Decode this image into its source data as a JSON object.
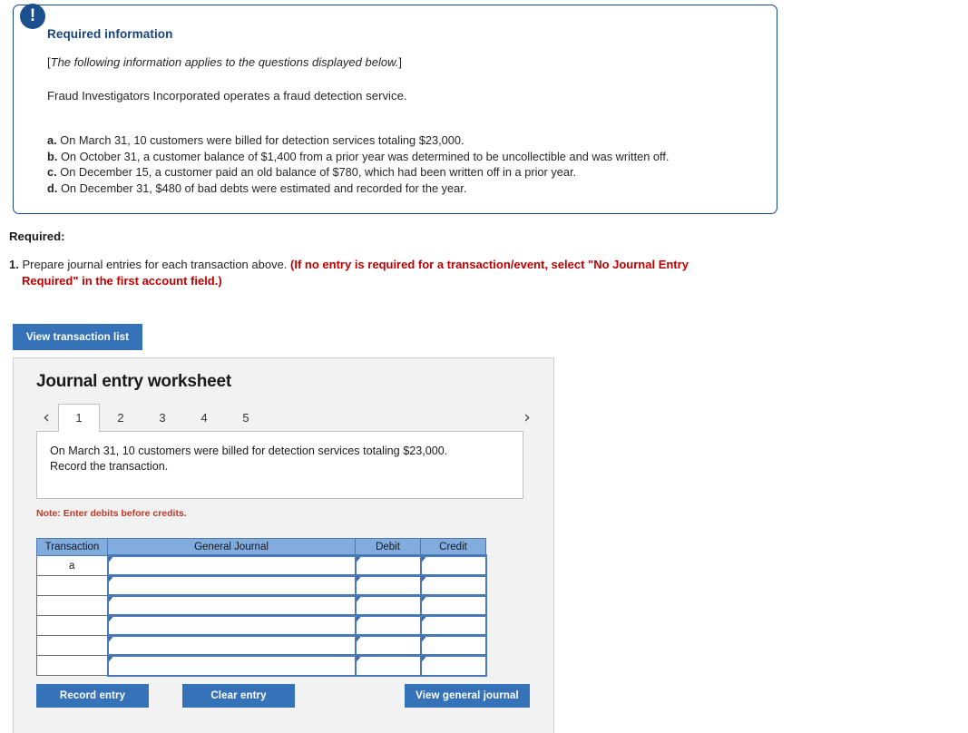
{
  "required_info": {
    "badge_icon": "exclamation-icon",
    "title": "Required information",
    "applies_note_open": "[",
    "applies_note": "The following information applies to the questions displayed below.",
    "applies_note_close": "]",
    "intro": "Fraud Investigators Incorporated operates a fraud detection service.",
    "items": [
      {
        "label": "a.",
        "text": "On March 31, 10 customers were billed for detection services totaling $23,000."
      },
      {
        "label": "b.",
        "text": "On October 31, a customer balance of $1,400 from a prior year was determined to be uncollectible and was written off."
      },
      {
        "label": "c.",
        "text": "On December 15, a customer paid an old balance of $780, which had been written off in a prior year."
      },
      {
        "label": "d.",
        "text": "On December 31, $480 of bad debts were estimated and recorded for the year."
      }
    ]
  },
  "required_section": {
    "heading": "Required:",
    "number": "1.",
    "task_text": "Prepare journal entries for each transaction above.",
    "task_emphasis_line1": "(If no entry is required for a transaction/event, select \"No Journal Entry",
    "task_emphasis_line2": "Required\" in the first account field.)"
  },
  "buttons": {
    "view_transaction_list": "View transaction list",
    "record_entry": "Record entry",
    "clear_entry": "Clear entry",
    "view_general_journal": "View general journal"
  },
  "worksheet": {
    "title": "Journal entry worksheet",
    "prev_arrow_icon": "chevron-left-icon",
    "next_arrow_icon": "chevron-right-icon",
    "tabs": [
      {
        "label": "1",
        "active": true
      },
      {
        "label": "2",
        "active": false
      },
      {
        "label": "3",
        "active": false
      },
      {
        "label": "4",
        "active": false
      },
      {
        "label": "5",
        "active": false
      }
    ],
    "prompt_line1": "On March 31, 10 customers were billed for detection services totaling $23,000.",
    "prompt_line2": "Record the transaction.",
    "note": "Note: Enter debits before credits.",
    "table": {
      "columns": [
        "Transaction",
        "General Journal",
        "Debit",
        "Credit"
      ],
      "rows": [
        {
          "transaction": "a",
          "general_journal": "",
          "debit": "",
          "credit": ""
        },
        {
          "transaction": "",
          "general_journal": "",
          "debit": "",
          "credit": ""
        },
        {
          "transaction": "",
          "general_journal": "",
          "debit": "",
          "credit": ""
        },
        {
          "transaction": "",
          "general_journal": "",
          "debit": "",
          "credit": ""
        },
        {
          "transaction": "",
          "general_journal": "",
          "debit": "",
          "credit": ""
        },
        {
          "transaction": "",
          "general_journal": "",
          "debit": "",
          "credit": ""
        }
      ]
    }
  },
  "colors": {
    "panel_border": "#17478a",
    "badge": "#1c4f8e",
    "heading_blue": "#16437f",
    "button_blue": "#3572b8",
    "table_header_blue": "#82abde",
    "table_cell_border_blue": "#4a7ab5",
    "warning_red": "#c00000",
    "note_red": "#c0392b",
    "panel_background": "#f2f2f2"
  }
}
